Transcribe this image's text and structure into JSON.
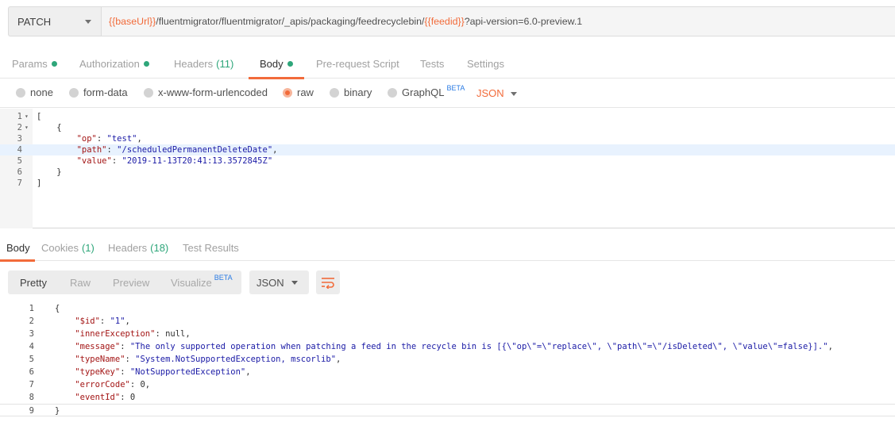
{
  "request": {
    "method": "PATCH",
    "url_parts": [
      {
        "text": "{{baseUrl}}",
        "type": "var"
      },
      {
        "text": "/fluentmigrator/fluentmigrator/_apis/packaging/feedrecyclebin/",
        "type": "plain"
      },
      {
        "text": "{{feedid}}",
        "type": "var"
      },
      {
        "text": "?api-version=6.0-preview.1",
        "type": "plain"
      }
    ]
  },
  "request_tabs": [
    {
      "label": "Params",
      "dot": true
    },
    {
      "label": "Authorization",
      "dot": true
    },
    {
      "label": "Headers",
      "count": "(11)"
    },
    {
      "label": "Body",
      "dot": true,
      "active": true
    },
    {
      "label": "Pre-request Script"
    },
    {
      "label": "Tests"
    },
    {
      "label": "Settings"
    }
  ],
  "body_types": {
    "options": [
      "none",
      "form-data",
      "x-www-form-urlencoded",
      "raw",
      "binary",
      "GraphQL"
    ],
    "selected": "raw",
    "graphql_badge": "BETA",
    "format": "JSON"
  },
  "request_body": {
    "lines": [
      "[",
      "    {",
      "        \"op\": \"test\",",
      "        \"path\": \"/scheduledPermanentDeleteDate\",",
      "        \"value\": \"2019-11-13T20:41:13.3572845Z\"",
      "    }",
      "]"
    ],
    "highlighted_line": 4
  },
  "response_tabs": [
    {
      "label": "Body",
      "active": true
    },
    {
      "label": "Cookies",
      "count": "(1)"
    },
    {
      "label": "Headers",
      "count": "(18)"
    },
    {
      "label": "Test Results"
    }
  ],
  "response_view": {
    "modes": [
      "Pretty",
      "Raw",
      "Preview",
      "Visualize"
    ],
    "active_mode": "Pretty",
    "visualize_badge": "BETA",
    "format": "JSON",
    "wrap_icon": "wrap-lines-icon"
  },
  "response_body": {
    "lines": [
      "{",
      "    \"$id\": \"1\",",
      "    \"innerException\": null,",
      "    \"message\": \"The only supported operation when patching a feed in the recycle bin is [{\\\"op\\\"=\\\"replace\\\", \\\"path\\\"=\\\"/isDeleted\\\", \\\"value\\\"=false}].\",",
      "    \"typeName\": \"System.NotSupportedException, mscorlib\",",
      "    \"typeKey\": \"NotSupportedException\",",
      "    \"errorCode\": 0,",
      "    \"eventId\": 0",
      "}"
    ],
    "highlighted_line": 9
  },
  "colors": {
    "accent": "#f26b3a",
    "status_green": "#2ea67a",
    "beta_blue": "#2a7be4"
  }
}
